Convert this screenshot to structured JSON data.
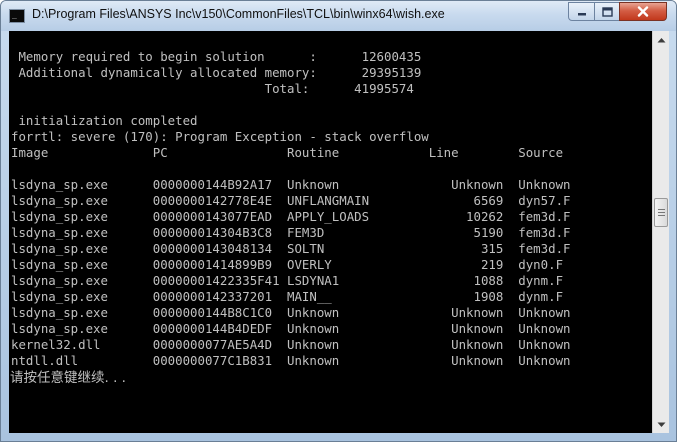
{
  "window": {
    "title": "D:\\Program Files\\ANSYS Inc\\v150\\CommonFiles\\TCL\\bin\\winx64\\wish.exe",
    "console_lines": [
      " Memory required to begin solution      :      12600435",
      " Additional dynamically allocated memory:      29395139",
      "                                  Total:      41995574",
      "",
      " initialization completed",
      "forrtl: severe (170): Program Exception - stack overflow",
      "Image              PC                Routine            Line        Source",
      "",
      "lsdyna_sp.exe      0000000144B92A17  Unknown               Unknown  Unknown",
      "lsdyna_sp.exe      0000000142778E4E  UNFLANGMAIN              6569  dyn57.F",
      "lsdyna_sp.exe      0000000143077EAD  APPLY_LOADS             10262  fem3d.F",
      "lsdyna_sp.exe      000000014304B3C8  FEM3D                    5190  fem3d.F",
      "lsdyna_sp.exe      0000000143048134  SOLTN                     315  fem3d.F",
      "lsdyna_sp.exe      00000001414899B9  OVERLY                    219  dyn0.F",
      "lsdyna_sp.exe      00000001422335F41 LSDYNA1                  1088  dynm.F",
      "lsdyna_sp.exe      0000000142337201  MAIN__                   1908  dynm.F",
      "lsdyna_sp.exe      0000000144B8C1C0  Unknown               Unknown  Unknown",
      "lsdyna_sp.exe      0000000144B4DEDF  Unknown               Unknown  Unknown",
      "kernel32.dll       0000000077AE5A4D  Unknown               Unknown  Unknown",
      "ntdll.dll          0000000077C1B831  Unknown               Unknown  Unknown"
    ],
    "prompt_text": "请按任意键继续. . ."
  },
  "icons": {
    "app": "console-icon",
    "minimize": "minimize-icon",
    "maximize": "maximize-icon",
    "close": "close-icon",
    "scroll_up": "chevron-up-icon",
    "scroll_down": "chevron-down-icon"
  },
  "colors": {
    "console_bg": "#000000",
    "console_text": "#c0c0c0",
    "close_button": "#c7412a"
  }
}
